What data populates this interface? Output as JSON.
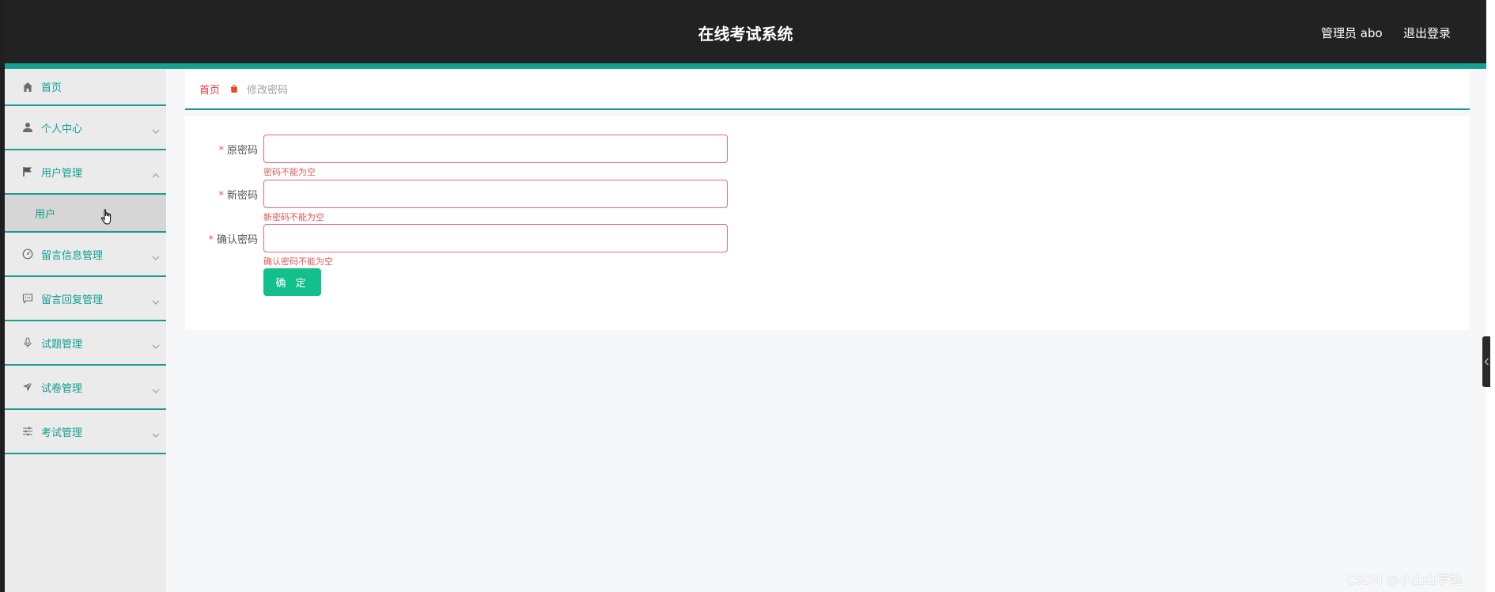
{
  "header": {
    "title": "在线考试系统",
    "user_label": "管理员 abo",
    "logout_label": "退出登录"
  },
  "sidebar": {
    "items": [
      {
        "label": "首页",
        "icon": "home-icon"
      },
      {
        "label": "个人中心",
        "icon": "user-icon"
      },
      {
        "label": "用户管理",
        "icon": "flag-icon",
        "expanded": true
      },
      {
        "label": "留言信息管理",
        "icon": "gauge-icon"
      },
      {
        "label": "留言回复管理",
        "icon": "message-icon"
      },
      {
        "label": "试题管理",
        "icon": "microphone-icon"
      },
      {
        "label": "试卷管理",
        "icon": "send-icon"
      },
      {
        "label": "考试管理",
        "icon": "sliders-icon"
      }
    ],
    "subitem": {
      "label": "用户"
    }
  },
  "breadcrumb": {
    "home": "首页",
    "current": "修改密码"
  },
  "form": {
    "fields": [
      {
        "label": "原密码",
        "value": "",
        "error": "密码不能为空"
      },
      {
        "label": "新密码",
        "value": "",
        "error": "新密码不能为空"
      },
      {
        "label": "确认密码",
        "value": "",
        "error": "确认密码不能为空"
      }
    ],
    "submit_label": "确 定"
  },
  "watermark": "CSDN @小山山学姐",
  "colors": {
    "header_bg": "#222222",
    "accent": "#15a190",
    "button": "#13c08b",
    "error": "#e05a5a"
  }
}
